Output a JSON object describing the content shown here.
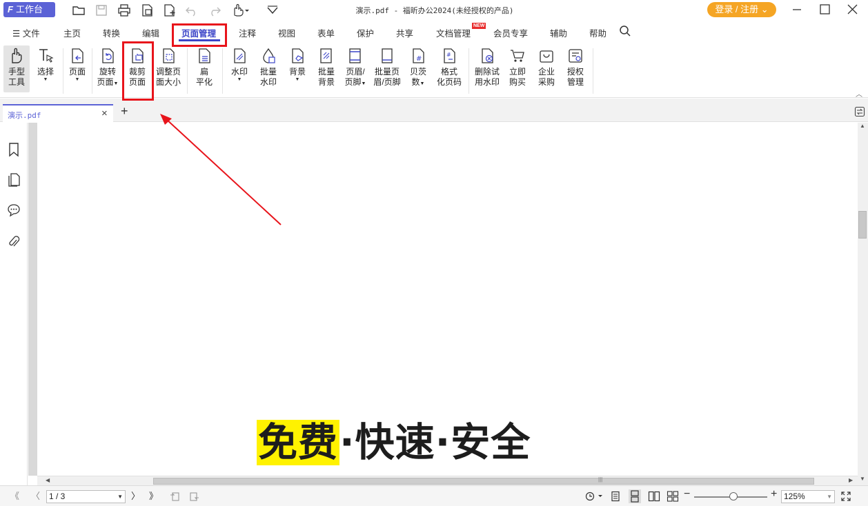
{
  "app": {
    "workbench_label": "工作台",
    "window_title": "演示.pdf - 福昕办公2024(未经授权的产品)",
    "login_label": "登录 / 注册",
    "login_chevron": "⌄"
  },
  "menu": {
    "file_label": "文件",
    "tabs": [
      "主页",
      "转换",
      "编辑",
      "页面管理",
      "注释",
      "视图",
      "表单",
      "保护",
      "共享",
      "文档管理",
      "会员专享",
      "辅助",
      "帮助"
    ],
    "active_tab": "页面管理",
    "new_badge": "NEW"
  },
  "ribbon": {
    "hand_tool": [
      "手型",
      "工具"
    ],
    "select": [
      "选择"
    ],
    "page": [
      "页面"
    ],
    "rotate_page": [
      "旋转",
      "页面"
    ],
    "crop_page": [
      "裁剪",
      "页面"
    ],
    "resize_page": [
      "调整页",
      "面大小"
    ],
    "flatten": [
      "扁",
      "平化"
    ],
    "watermark": [
      "水印"
    ],
    "batch_watermark": [
      "批量",
      "水印"
    ],
    "background": [
      "背景"
    ],
    "batch_background": [
      "批量",
      "背景"
    ],
    "header_footer": [
      "页眉/",
      "页脚"
    ],
    "batch_header_footer": [
      "批量页",
      "眉/页脚"
    ],
    "bates": [
      "贝茨",
      "数"
    ],
    "format_page_numbers": [
      "格式",
      "化页码"
    ],
    "remove_trial_watermark": [
      "删除试",
      "用水印"
    ],
    "buy_now": [
      "立即",
      "购买"
    ],
    "enterprise_purchase": [
      "企业",
      "采购"
    ],
    "license_management": [
      "授权",
      "管理"
    ]
  },
  "document": {
    "tab_label": "演示.pdf",
    "tab_close": "×",
    "add_tab": "+",
    "slogan_highlight": "免费",
    "slogan_rest": "·快速·安全"
  },
  "status": {
    "page_value": "1 / 3",
    "zoom_value": "125%"
  },
  "colors": {
    "accent": "#3c45c8",
    "workbench_bg": "#5b62d6",
    "login_bg": "#f5a524",
    "highlight": "#fff200",
    "annotation_red": "#e8141b"
  }
}
